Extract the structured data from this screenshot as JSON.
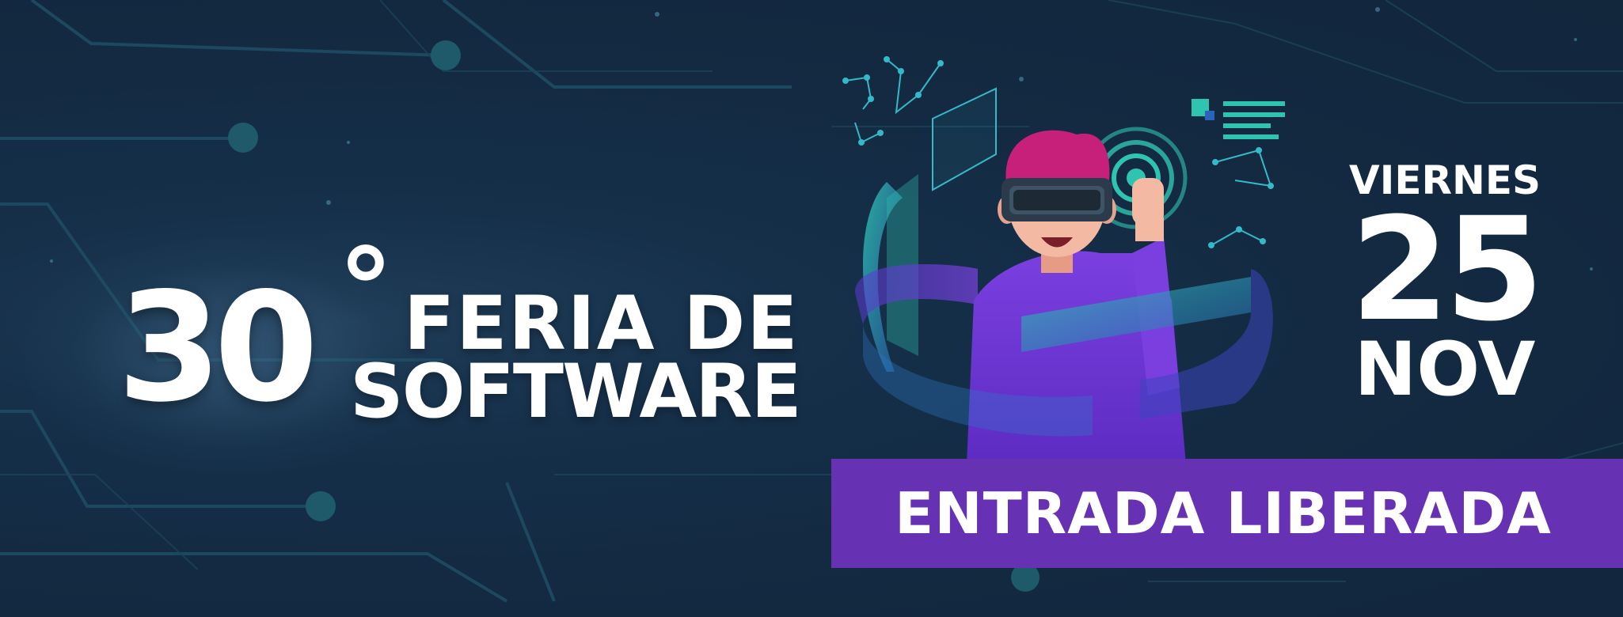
{
  "event": {
    "number": "30",
    "degree": "°",
    "title_line1": "FERIA DE",
    "title_line2": "SOFTWARE"
  },
  "date": {
    "weekday": "VIERNES",
    "day": "25",
    "month": "NOV"
  },
  "cta": {
    "label": "ENTRADA LIBERADA"
  },
  "illustration": {
    "subject": "person-wearing-vr-headset",
    "icons": [
      "constellation-icon",
      "target-rings-icon",
      "hologram-panel-icon",
      "menu-lines-icon"
    ]
  },
  "colors": {
    "background": "#14283f",
    "circuit": "#1f5a6a",
    "accent_purple": "#6731b3",
    "accent_teal": "#2fc4b0",
    "text": "#ffffff"
  }
}
